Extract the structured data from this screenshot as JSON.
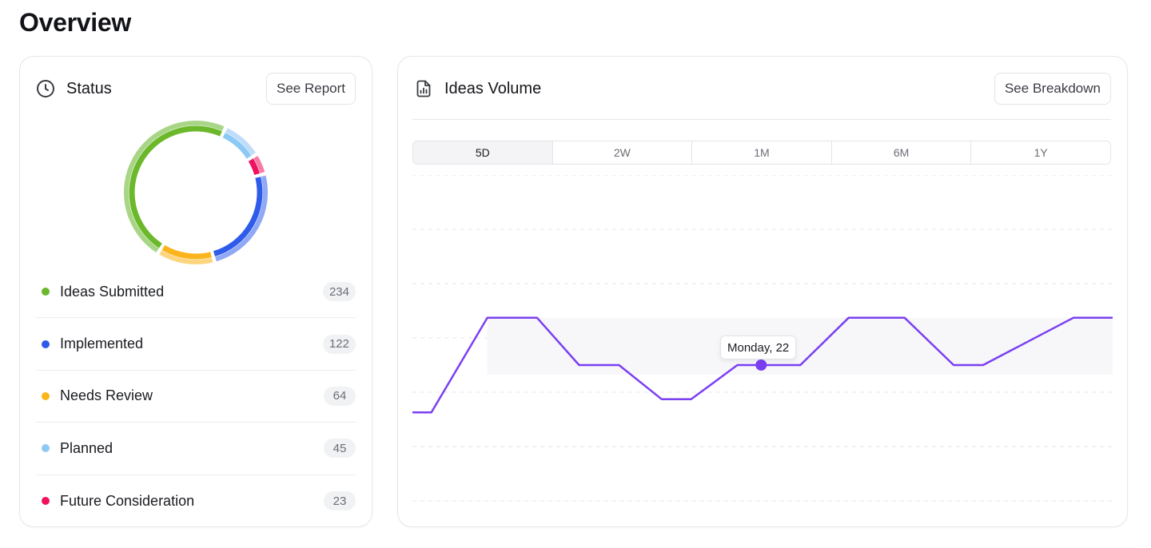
{
  "page": {
    "title": "Overview"
  },
  "status": {
    "title": "Status",
    "icon": "clock-icon",
    "report_button": "See Report",
    "items": [
      {
        "label": "Ideas Submitted",
        "count": "234",
        "color": "#6BB82A",
        "light": "#A8D686"
      },
      {
        "label": "Implemented",
        "count": "122",
        "color": "#2F5BEA",
        "light": "#8FA9F5"
      },
      {
        "label": "Needs Review",
        "count": "64",
        "color": "#FBB41C",
        "light": "#FCD57E"
      },
      {
        "label": "Planned",
        "count": "45",
        "color": "#8CC9F5",
        "light": "#BFDDFA"
      },
      {
        "label": "Future Consideration",
        "count": "23",
        "color": "#F0115F",
        "light": "#F77BA6"
      }
    ]
  },
  "volume": {
    "title": "Ideas Volume",
    "icon": "report-chart-icon",
    "breakdown_button": "See Breakdown",
    "ranges": [
      "5D",
      "2W",
      "1M",
      "6M",
      "1Y"
    ],
    "active_range": "5D",
    "tooltip": "Monday, 22",
    "line_color": "#7B3FF2"
  },
  "chart_data": {
    "type": "line",
    "xlim": [
      0,
      1
    ],
    "ylim": [
      0,
      6
    ],
    "series": [
      {
        "x": [
          0,
          0.027,
          0.107,
          0.178,
          0.238,
          0.295,
          0.356,
          0.398,
          0.464,
          0.554,
          0.623,
          0.703,
          0.773,
          0.815,
          0.944,
          1
        ],
        "values": [
          1.63,
          1.63,
          3.37,
          3.37,
          2.5,
          2.5,
          1.87,
          1.87,
          2.5,
          2.5,
          3.37,
          3.37,
          2.5,
          2.5,
          3.37,
          3.37
        ]
      }
    ],
    "highlight": {
      "x": 0.498,
      "value": 2.5
    },
    "grid": true
  }
}
